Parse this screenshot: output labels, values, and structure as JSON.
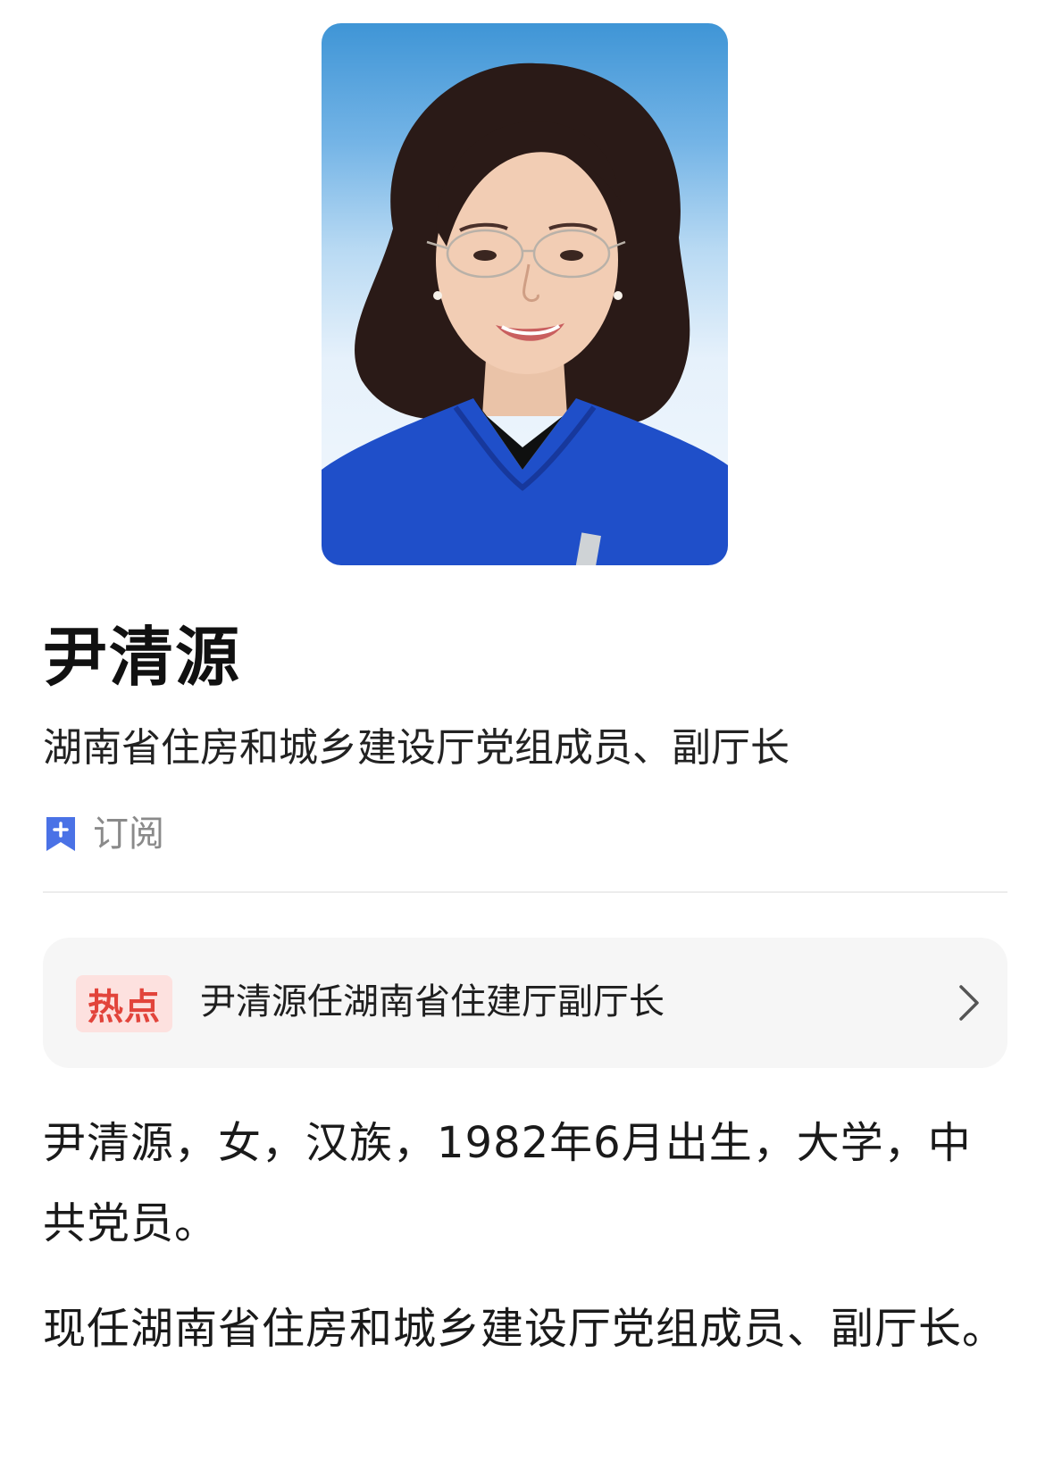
{
  "profile": {
    "name": "尹清源",
    "title": "湖南省住房和城乡建设厅党组成员、副厅长",
    "photo_icon": "portrait-photo"
  },
  "subscribe": {
    "label": "订阅",
    "icon": "bookmark-plus-icon",
    "icon_color": "#4a72e6"
  },
  "hot": {
    "badge": "热点",
    "text": "尹清源任湖南省住建厅副厅长",
    "badge_color": "#e2443b",
    "badge_bg": "#fde1df"
  },
  "bio": {
    "paragraph1": "尹清源，女，汉族，1982年6月出生，大学，中共党员。",
    "paragraph2": "现任湖南省住房和城乡建设厅党组成员、副厅长。"
  }
}
